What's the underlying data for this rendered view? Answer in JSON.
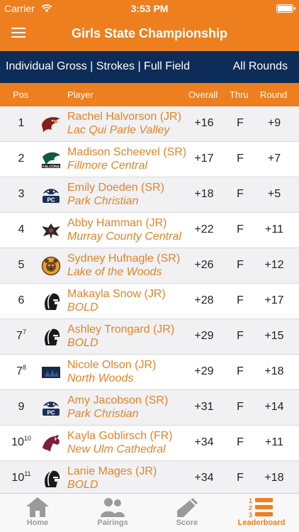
{
  "status": {
    "carrier": "Carrier",
    "time": "3:53 PM"
  },
  "nav": {
    "title": "Girls State Championship"
  },
  "filter": {
    "label": "Individual Gross | Strokes | Full Field",
    "rounds": "All Rounds"
  },
  "columns": {
    "pos": "Pos",
    "player": "Player",
    "overall": "Overall",
    "thru": "Thru",
    "round": "Round"
  },
  "rows": [
    {
      "pos": "1",
      "pos_sup": "",
      "name": "Rachel Halvorson (JR)",
      "school": "Lac Qui Parle Valley",
      "overall": "+16",
      "thru": "F",
      "round": "+9",
      "logo": "eagle-logo"
    },
    {
      "pos": "2",
      "pos_sup": "",
      "name": "Madison Scheevel (SR)",
      "school": "Fillmore Central",
      "overall": "+17",
      "thru": "F",
      "round": "+7",
      "logo": "falcons-logo"
    },
    {
      "pos": "3",
      "pos_sup": "",
      "name": "Emily Doeden (SR)",
      "school": "Park Christian",
      "overall": "+18",
      "thru": "F",
      "round": "+5",
      "logo": "falcon-pc-logo"
    },
    {
      "pos": "4",
      "pos_sup": "",
      "name": "Abby Hamman (JR)",
      "school": "Murray County Central",
      "overall": "+22",
      "thru": "F",
      "round": "+11",
      "logo": "rebels-logo"
    },
    {
      "pos": "5",
      "pos_sup": "",
      "name": "Sydney Hufnagle (SR)",
      "school": "Lake of the Woods",
      "overall": "+26",
      "thru": "F",
      "round": "+12",
      "logo": "bears-logo"
    },
    {
      "pos": "6",
      "pos_sup": "",
      "name": "Makayla Snow (JR)",
      "school": "BOLD",
      "overall": "+28",
      "thru": "F",
      "round": "+17",
      "logo": "warriors-logo"
    },
    {
      "pos": "7",
      "pos_sup": "7",
      "name": "Ashley Trongard (JR)",
      "school": "BOLD",
      "overall": "+29",
      "thru": "F",
      "round": "+15",
      "logo": "warriors-logo"
    },
    {
      "pos": "7",
      "pos_sup": "8",
      "name": "Nicole Olson (JR)",
      "school": "North Woods",
      "overall": "+29",
      "thru": "F",
      "round": "+18",
      "logo": "northwoods-logo"
    },
    {
      "pos": "9",
      "pos_sup": "",
      "name": "Amy Jacobson (SR)",
      "school": "Park Christian",
      "overall": "+31",
      "thru": "F",
      "round": "+14",
      "logo": "falcon-pc-logo"
    },
    {
      "pos": "10",
      "pos_sup": "10",
      "name": "Kayla Goblirsch (FR)",
      "school": "New Ulm Cathedral",
      "overall": "+34",
      "thru": "F",
      "round": "+11",
      "logo": "greyhounds-logo"
    },
    {
      "pos": "10",
      "pos_sup": "11",
      "name": "Lanie Mages (JR)",
      "school": "BOLD",
      "overall": "+34",
      "thru": "F",
      "round": "+18",
      "logo": "warriors-logo"
    }
  ],
  "tabs": [
    {
      "label": "Home",
      "icon": "home-icon",
      "active": false
    },
    {
      "label": "Pairings",
      "icon": "people-icon",
      "active": false
    },
    {
      "label": "Score",
      "icon": "pencil-icon",
      "active": false
    },
    {
      "label": "Leaderboard",
      "icon": "leaderboard-icon",
      "active": true
    }
  ],
  "colors": {
    "accent": "#ee7f1f",
    "navy": "#0d2c57",
    "link": "#e0842a",
    "tab_inactive": "#9a9a9a"
  }
}
